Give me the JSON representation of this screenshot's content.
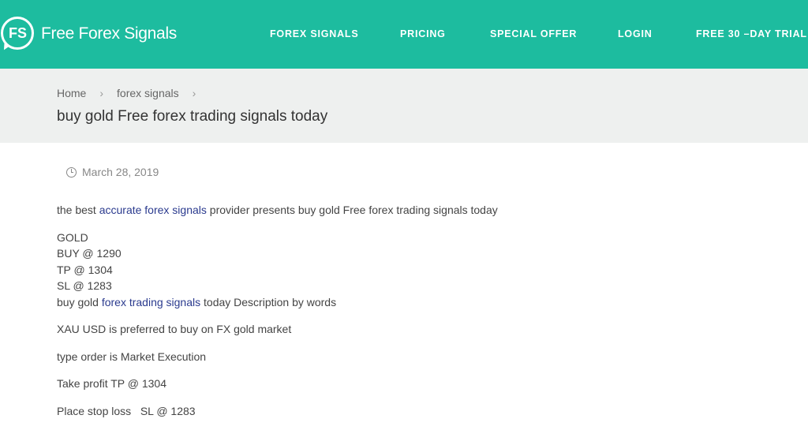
{
  "header": {
    "logo_initials": "FS",
    "logo_text": "Free Forex Signals",
    "nav": [
      {
        "label": "FOREX SIGNALS"
      },
      {
        "label": "PRICING"
      },
      {
        "label": "SPECIAL OFFER"
      },
      {
        "label": "LOGIN"
      },
      {
        "label": "FREE 30 –DAY TRIAL"
      }
    ],
    "brand_color": "#1dbc9f"
  },
  "breadcrumb": {
    "home": "Home",
    "category": "forex signals",
    "separator": "›"
  },
  "page_title": "buy gold Free forex trading signals today",
  "meta": {
    "date": "March 28, 2019",
    "icon": "clock-icon"
  },
  "content": {
    "intro_before": "the best ",
    "intro_link": "accurate forex signals",
    "intro_after": " provider presents buy gold Free forex trading signals today",
    "signal_lines": [
      "GOLD",
      "BUY @ 1290",
      "TP @ 1304",
      "SL @ 1283"
    ],
    "desc_before": "buy gold ",
    "desc_link": "forex trading signals",
    "desc_after": " today Description by words",
    "paragraphs": [
      "XAU USD is preferred to buy on FX gold market",
      "type order is Market Execution",
      "Take profit TP @ 1304",
      "Place stop loss   SL @ 1283"
    ]
  }
}
